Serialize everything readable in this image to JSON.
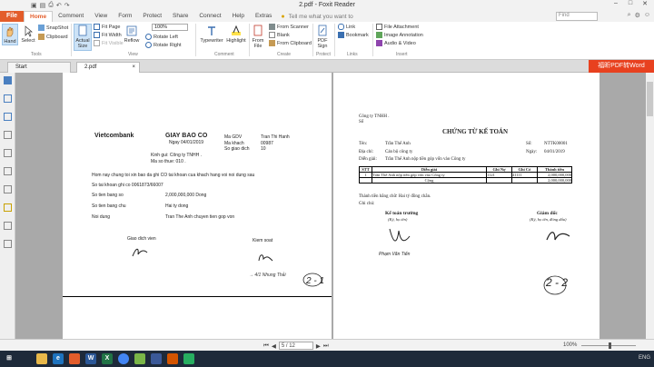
{
  "window": {
    "title": "2.pdf - Foxit Reader"
  },
  "menu": {
    "file": "File",
    "tabs": [
      "Home",
      "Comment",
      "View",
      "Form",
      "Protect",
      "Share",
      "Connect",
      "Help",
      "Extras"
    ],
    "tell_me": "Tell me what you want to",
    "find_placeholder": "Find"
  },
  "ribbon": {
    "hand": "Hand",
    "select": "Select",
    "snapshot": "SnapShot",
    "clipboard": "Clipboard",
    "actual_size": "Actual Size",
    "fit_page": "Fit Page",
    "fit_width": "Fit Width",
    "fit_visible": "Fit Visible",
    "reflow": "Reflow",
    "zoom_value": "100%",
    "rotate_left": "Rotate Left",
    "rotate_right": "Rotate Right",
    "typewriter": "Typewriter",
    "highlight": "Highlight",
    "from_file": "From File",
    "from_scanner": "From Scanner",
    "blank": "Blank",
    "from_clipboard": "From Clipboard",
    "pdf_sign": "PDF Sign",
    "link": "Link",
    "bookmark": "Bookmark",
    "file_attachment": "File Attachment",
    "image_annotation": "Image Annotation",
    "audio_video": "Audio & Video",
    "groups": {
      "tools": "Tools",
      "view": "View",
      "comment": "Comment",
      "create": "Create",
      "protect": "Protect",
      "links": "Links",
      "insert": "Insert"
    }
  },
  "doc_tabs": {
    "start": "Start",
    "current": "2.pdf",
    "promo": "福昕PDF转Word"
  },
  "left_page": {
    "bank": "Vietcombank",
    "title": "GIAY BAO CO",
    "date": "Ngay 04/01/2019",
    "ma_gdv_label": "Ma GDV",
    "ma_gdv_value": "Tran Thi Hanh",
    "ma_kh_label": "Ma khach",
    "ma_kh_value": "00987",
    "so_gd_label": "So giao dich",
    "so_gd_value": "10",
    "kinh_gui": "Kinh gui: Công ty TNHH .",
    "ma_so_thue": "Ma so thue: 010 .",
    "hom_nay": "Hom nay chung toi xin bao da ghi CO tai khoan cua khach hang voi noi dung sau",
    "so_tk": "So tai khoan ghi co 0061873/66007",
    "so_tien_so_label": "So tien bang so",
    "so_tien_so_value": "2,000,000,000   Dong",
    "so_tien_chu_label": "So tien bang chu",
    "so_tien_chu_value": "Hai ty dong",
    "noi_dung_label": "Noi dung",
    "noi_dung_value": "Tran The Anh chuyen tien gop von",
    "giao_dich_vien": "Giao dich vien",
    "kiem_soat": "Kiem soat",
    "handnote": "2 - 1"
  },
  "right_page": {
    "company": "Công ty TNHH .",
    "so": "Số",
    "title": "CHỨNG TỪ KẾ TOÁN",
    "ten_label": "Tên:",
    "ten_value": "Trần Thế Anh",
    "so_label": "Số:",
    "so_value": "NTTK00001",
    "dia_chi_label": "Địa chỉ:",
    "dia_chi_value": "Cán bộ công ty",
    "ngay_label": "Ngày:",
    "ngay_value": "04/01/2019",
    "dien_giai_label": "Diễn giải:",
    "dien_giai_value": "Trần Thế Anh nộp tiền góp vốn vào Công ty",
    "table": {
      "headers": [
        "STT",
        "Diễn giải",
        "Ghi Nợ",
        "Ghi Có",
        "Thành tiền"
      ],
      "rows": [
        [
          "1",
          "Trần Thế Anh nộp tiền góp vốn vào Công ty",
          "1121",
          "41111",
          "2,000,000,000"
        ]
      ],
      "total_label": "Cộng",
      "total_value": "2,000,000,000"
    },
    "bang_chu": "Thành tiền bằng chữ:  Hai tỷ đồng chẵn.",
    "ghi_chu": "Ghi chú:",
    "ke_toan_truong": "Kế toán trưởng",
    "ky_ho_ten1": "(Ký, họ tên)",
    "giam_doc": "Giám đốc",
    "ky_ho_ten2": "(Ký, họ tên, đóng dấu)",
    "handnote": "2 - 2"
  },
  "status": {
    "page": "5 / 12",
    "zoom": "100%"
  },
  "taskbar": {
    "tray": "ENG"
  }
}
